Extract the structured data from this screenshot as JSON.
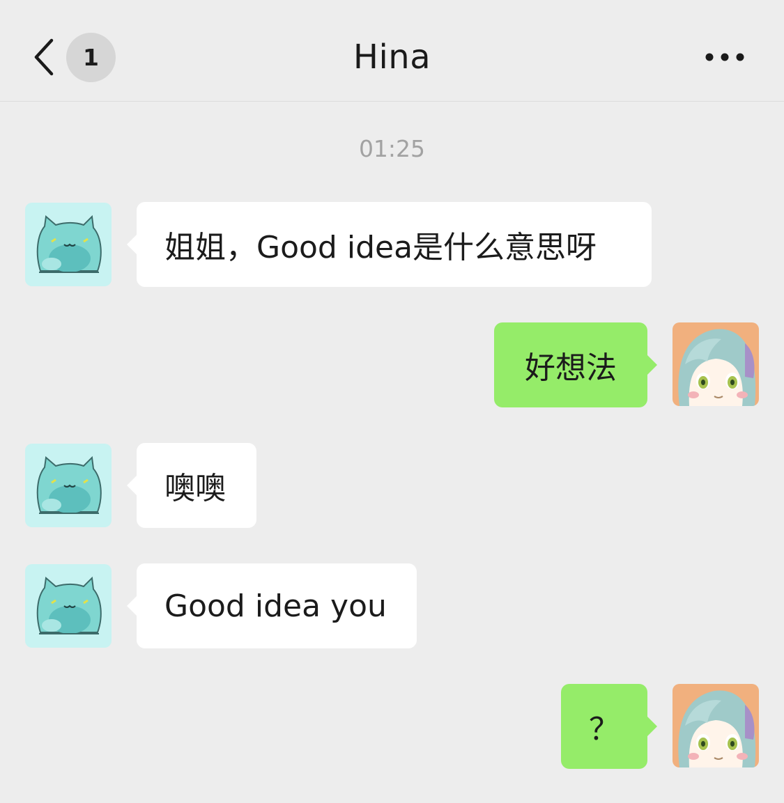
{
  "header": {
    "back_icon": "chevron-left-icon",
    "unread_count": "1",
    "title": "Hina",
    "more_icon": "ellipsis-icon"
  },
  "timestamp": "01:25",
  "messages": [
    {
      "side": "incoming",
      "text": "姐姐，Good idea是什么意思呀"
    },
    {
      "side": "outgoing",
      "text": "好想法"
    },
    {
      "side": "incoming",
      "text": "噢噢"
    },
    {
      "side": "incoming",
      "text": "Good idea you"
    },
    {
      "side": "outgoing",
      "text": "？"
    }
  ],
  "colors": {
    "background": "#ededed",
    "incoming_bubble": "#ffffff",
    "outgoing_bubble": "#95ec69",
    "timestamp_text": "#a2a2a2"
  }
}
